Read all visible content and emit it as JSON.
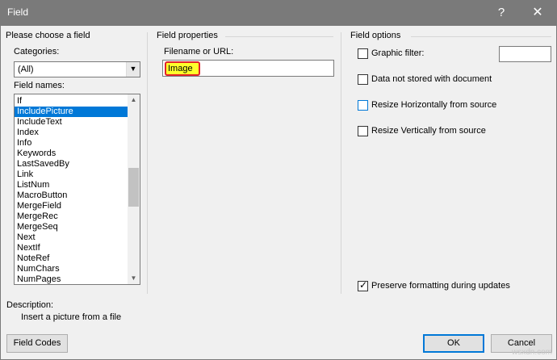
{
  "window": {
    "title": "Field",
    "help_glyph": "?",
    "close_glyph": "✕"
  },
  "left_panel": {
    "heading": "Please choose a field",
    "categories_label": "Categories:",
    "categories_value": "(All)",
    "field_names_label": "Field names:",
    "field_names": [
      "If",
      "IncludePicture",
      "IncludeText",
      "Index",
      "Info",
      "Keywords",
      "LastSavedBy",
      "Link",
      "ListNum",
      "MacroButton",
      "MergeField",
      "MergeRec",
      "MergeSeq",
      "Next",
      "NextIf",
      "NoteRef",
      "NumChars",
      "NumPages"
    ],
    "selected_field": "IncludePicture"
  },
  "middle_panel": {
    "heading": "Field properties",
    "filename_label": "Filename or URL:",
    "filename_value": "Image"
  },
  "right_panel": {
    "heading": "Field options",
    "graphic_filter": "Graphic filter:",
    "data_not_stored": "Data not stored with document",
    "resize_horizontally": "Resize Horizontally from source",
    "resize_vertically": "Resize Vertically from source",
    "preserve_formatting": "Preserve formatting during updates"
  },
  "description": {
    "label": "Description:",
    "text": "Insert a picture from a file"
  },
  "buttons": {
    "field_codes": "Field Codes",
    "ok": "OK",
    "cancel": "Cancel"
  },
  "watermark": "wsxdn.com",
  "colors": {
    "titlebar": "#7a7a7a",
    "selection": "#0078d7",
    "highlight": "#ffff2b",
    "highlight_border": "#e1222a"
  }
}
